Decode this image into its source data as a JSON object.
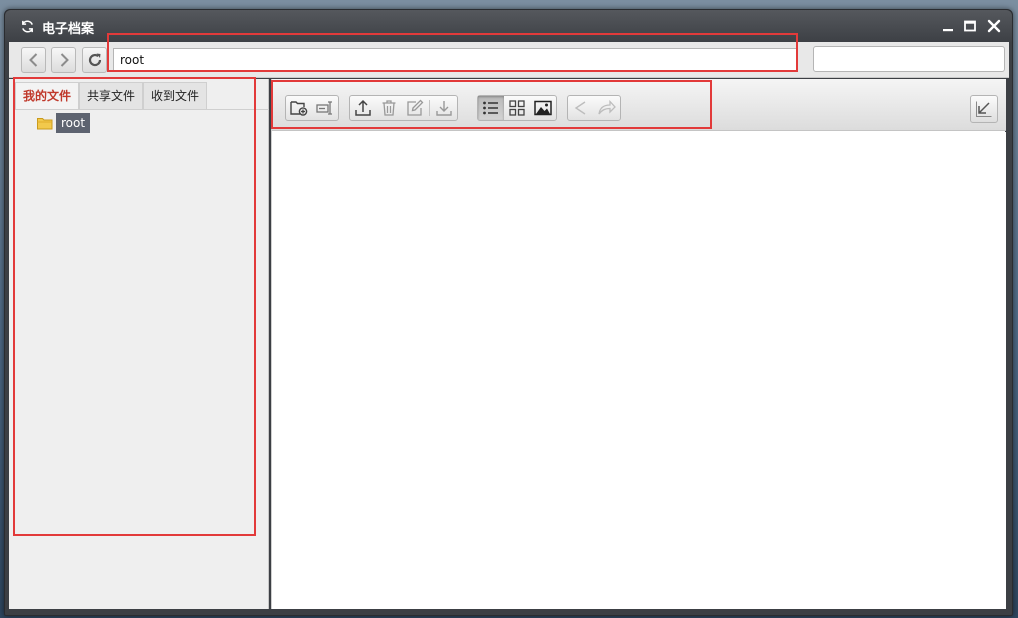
{
  "window": {
    "title": "电子档案",
    "minimize_icon": "minimize-icon",
    "maximize_icon": "maximize-icon",
    "close_icon": "close-icon"
  },
  "address_bar": {
    "back_icon": "chevron-left-icon",
    "forward_icon": "chevron-right-icon",
    "refresh_icon": "refresh-icon",
    "path_value": "root",
    "search_value": ""
  },
  "left_pane": {
    "tabs": [
      {
        "label": "我的文件",
        "active": true
      },
      {
        "label": "共享文件",
        "active": false
      },
      {
        "label": "收到文件",
        "active": false
      }
    ],
    "tree": [
      {
        "label": "root",
        "icon": "folder-icon",
        "selected": true
      }
    ]
  },
  "toolbar": {
    "groups": [
      [
        "new-folder-icon",
        "rename-icon"
      ],
      [
        "upload-icon",
        "delete-icon",
        "edit-icon",
        "download-icon"
      ],
      [
        "list-view-icon",
        "grid-view-icon",
        "image-view-icon"
      ],
      [
        "share-icon",
        "forward-icon"
      ]
    ],
    "active_view": "list-view-icon",
    "collapse_icon": "collapse-icon"
  },
  "colors": {
    "active_tab_text": "#c0392b",
    "selected_tree_bg": "#5d6370",
    "annotation": "#e23a3a",
    "titlebar": "#3d4045"
  }
}
